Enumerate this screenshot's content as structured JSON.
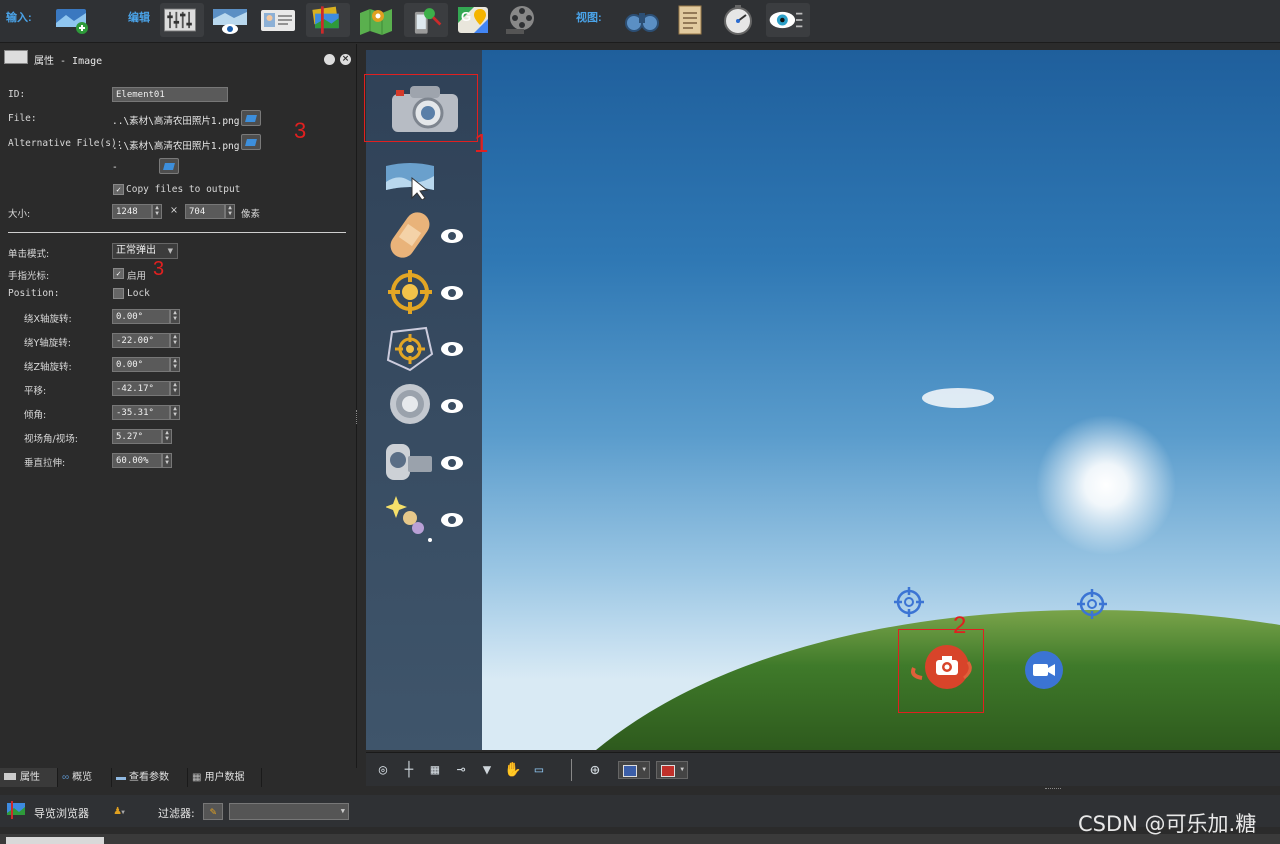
{
  "toolbar": {
    "input_label": "输入:",
    "edit_label": "编辑",
    "view_label": "视图:",
    "input_icons": [
      "panorama-add-icon"
    ],
    "edit_icons": [
      "mixer-icon",
      "tour-preview-icon",
      "id-card-icon",
      "pano-stack-icon",
      "map-icon",
      "phone-marker-icon",
      "google-maps-icon",
      "film-reel-icon"
    ],
    "view_icons": [
      "binoculars-icon",
      "notes-icon",
      "stopwatch-icon",
      "eye-list-icon"
    ]
  },
  "properties": {
    "title": "属性 - Image",
    "id_label": "ID:",
    "id_value": "Element01",
    "file_label": "File:",
    "file_value": "..\\素材\\高清农田照片1.png",
    "alt_files_label": "Alternative File(s):",
    "alt_files_value": "..\\素材\\高清农田照片1.png",
    "dash_value": "-",
    "copy_files_label": "Copy files to output",
    "size_label": "大小:",
    "width_value": "1248",
    "times_sign": "×",
    "height_value": "704",
    "unit_label": "像素",
    "click_mode_label": "单击模式:",
    "click_mode_value": "正常弹出",
    "finger_cursor_label": "手指光标:",
    "finger_cursor_value": "启用",
    "position_label": "Position:",
    "lock_label": "Lock",
    "fields": [
      {
        "label": "绕X轴旋转:",
        "value": "0.00°"
      },
      {
        "label": "绕Y轴旋转:",
        "value": "-22.00°"
      },
      {
        "label": "绕Z轴旋转:",
        "value": "0.00°"
      },
      {
        "label": "平移:",
        "value": "-42.17°"
      },
      {
        "label": "倾角:",
        "value": "-35.31°"
      },
      {
        "label": "视场角/视场:",
        "value": "5.27°"
      },
      {
        "label": "垂直拉伸:",
        "value": "60.00%"
      }
    ]
  },
  "annotations": {
    "mark1": "1",
    "mark2": "2",
    "mark3a": "3",
    "mark3b": "3"
  },
  "tabs": [
    "属性",
    "概览",
    "查看参数",
    "用户数据"
  ],
  "nav": {
    "title": "导览浏览器",
    "filter_label": "过滤器:",
    "filter_value": ""
  },
  "watermark": "CSDN @可乐加.糖",
  "colors": {
    "accent_blue": "#4aa3e8",
    "annotation_red": "#e02020",
    "hotspot_orange": "#d8442a",
    "hotspot_blue": "#3b74d4"
  }
}
